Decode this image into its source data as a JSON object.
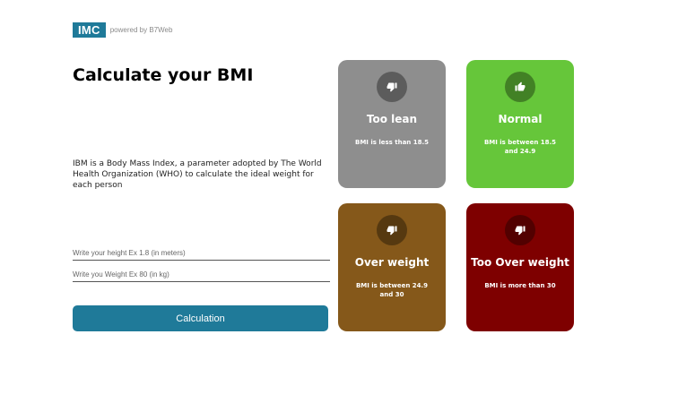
{
  "header": {
    "logo_text": "IMC",
    "powered_by": "powered by B7Web"
  },
  "main": {
    "title": "Calculate your BMI",
    "description": "IBM is a Body Mass Index, a parameter adopted by The World Health Organization (WHO) to calculate the ideal weight for each person",
    "height_placeholder": "Write your height Ex 1.8 (in meters)",
    "weight_placeholder": "Write you Weight Ex 80 (in kg)",
    "height_value": "",
    "weight_value": "",
    "button_label": "Calculation"
  },
  "cards": [
    {
      "title": "Too lean",
      "text": "BMI is less than 18.5",
      "color": "#8e8e8e",
      "icon": "thumbs-down-icon"
    },
    {
      "title": "Normal",
      "text": "BMI is between 18.5 and 24.9",
      "color": "#66c63a",
      "icon": "thumbs-up-icon"
    },
    {
      "title": "Over weight",
      "text": "BMI is between 24.9 and 30",
      "color": "#85581a",
      "icon": "thumbs-down-icon"
    },
    {
      "title": "Too Over weight",
      "text": "BMI is more than 30",
      "color": "#7e0000",
      "icon": "thumbs-down-icon"
    }
  ],
  "colors": {
    "accent": "#1f7a99"
  }
}
